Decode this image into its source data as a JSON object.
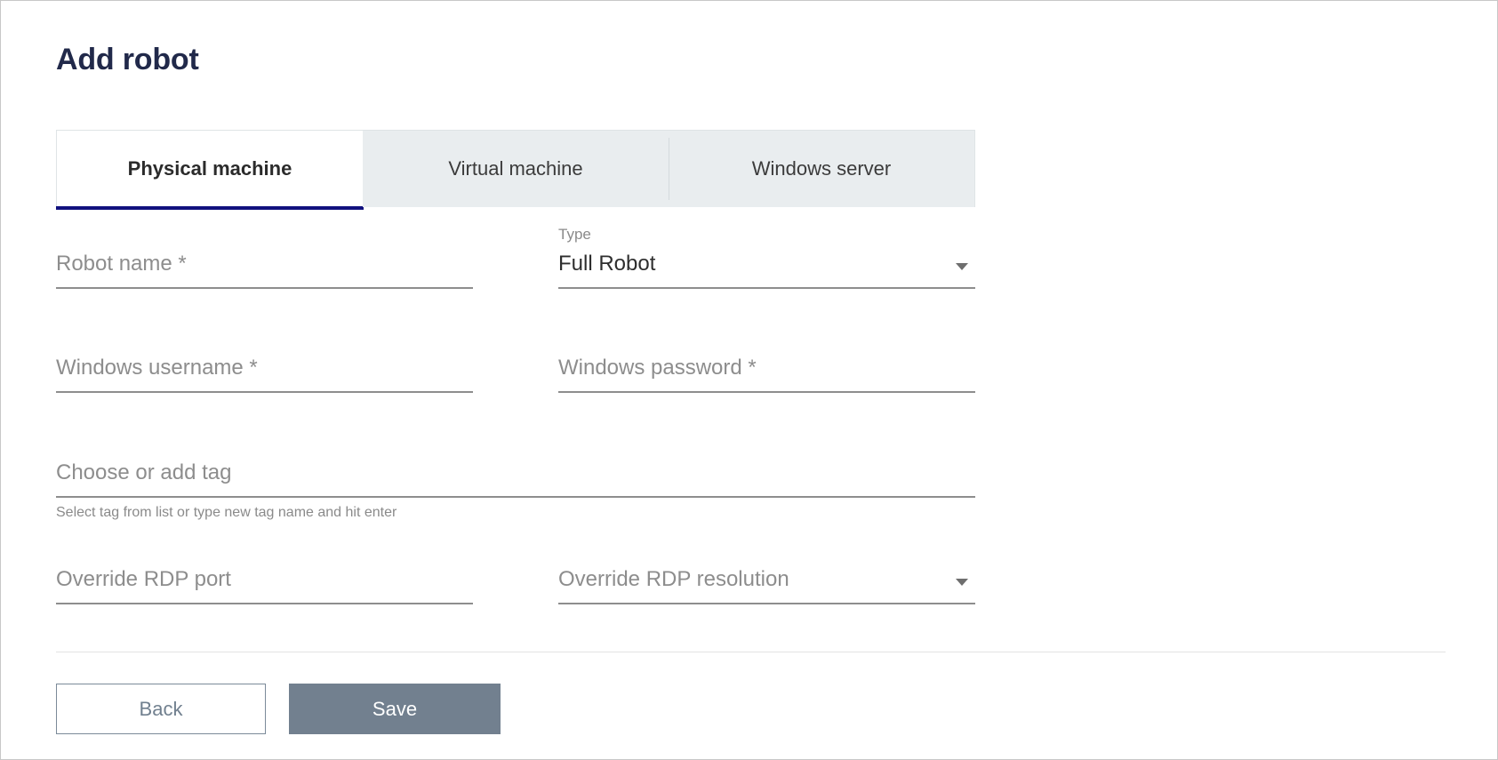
{
  "page": {
    "title": "Add robot"
  },
  "tabs": [
    {
      "label": "Physical machine",
      "active": true
    },
    {
      "label": "Virtual machine",
      "active": false
    },
    {
      "label": "Windows server",
      "active": false
    }
  ],
  "form": {
    "robot_name": {
      "placeholder": "Robot name *",
      "value": ""
    },
    "type": {
      "label": "Type",
      "value": "Full Robot",
      "caret_icon": "chevron-down-icon"
    },
    "windows_username": {
      "placeholder": "Windows username *",
      "value": ""
    },
    "windows_password": {
      "placeholder": "Windows password *",
      "value": ""
    },
    "tag": {
      "placeholder": "Choose or add tag",
      "value": "",
      "helper": "Select tag from list or type new tag name and hit enter"
    },
    "override_rdp_port": {
      "placeholder": "Override RDP port",
      "value": ""
    },
    "override_rdp_resolution": {
      "placeholder": "Override RDP resolution",
      "value": "",
      "caret_icon": "chevron-down-icon"
    }
  },
  "actions": {
    "back_label": "Back",
    "save_label": "Save"
  },
  "colors": {
    "title": "#21294a",
    "active_tab_underline": "#11117e",
    "inactive_tab_bg": "#e9edef",
    "save_button_bg": "#72808f",
    "back_button_border": "#7b8a99",
    "field_underline": "#8e8e8e",
    "placeholder_text": "#8d8d8d"
  }
}
